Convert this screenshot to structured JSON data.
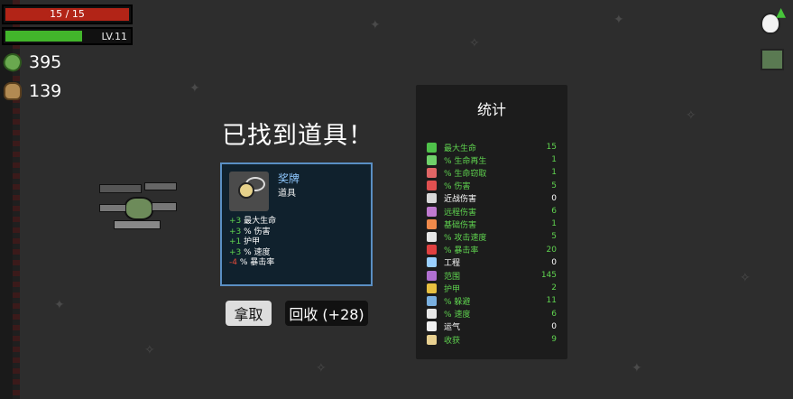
{
  "hud": {
    "hp_text": "15 / 15",
    "hp_fraction": 1.0,
    "level_text": "LV.11",
    "xp_fraction": 0.62,
    "materials": "395",
    "bag": "139"
  },
  "dialog": {
    "title": "已找到道具！",
    "item_name": "奖牌",
    "item_type": "道具",
    "effects": [
      {
        "prefix": "+3",
        "text": " 最大生命",
        "kind": "pos"
      },
      {
        "prefix": "+3",
        "text": " % 伤害",
        "kind": "pos"
      },
      {
        "prefix": "+1",
        "text": " 护甲",
        "kind": "pos"
      },
      {
        "prefix": "+3",
        "text": " % 速度",
        "kind": "pos"
      },
      {
        "prefix": "-4",
        "text": " % 暴击率",
        "kind": "neg"
      }
    ],
    "take_label": "拿取",
    "recycle_label": "回收 (+28)"
  },
  "stats": {
    "title": "统计",
    "rows": [
      {
        "icon": "heart-icon",
        "label": "最大生命",
        "value": "15",
        "color": "#5fd34f",
        "icon_color": "#4fc24a"
      },
      {
        "icon": "regen-icon",
        "label": "% 生命再生",
        "value": "1",
        "color": "#5fd34f",
        "icon_color": "#6fd06a"
      },
      {
        "icon": "lifesteal-icon",
        "label": "% 生命窃取",
        "value": "1",
        "color": "#5fd34f",
        "icon_color": "#e06666"
      },
      {
        "icon": "damage-icon",
        "label": "% 伤害",
        "value": "5",
        "color": "#5fd34f",
        "icon_color": "#e05050"
      },
      {
        "icon": "melee-icon",
        "label": "近战伤害",
        "value": "0",
        "color": "#ffffff",
        "icon_color": "#d8d8d8"
      },
      {
        "icon": "ranged-icon",
        "label": "远程伤害",
        "value": "6",
        "color": "#5fd34f",
        "icon_color": "#c07ad0"
      },
      {
        "icon": "elemental-icon",
        "label": "基础伤害",
        "value": "1",
        "color": "#5fd34f",
        "icon_color": "#f08a4b"
      },
      {
        "icon": "attack-speed-icon",
        "label": "% 攻击速度",
        "value": "5",
        "color": "#5fd34f",
        "icon_color": "#e6e6e6"
      },
      {
        "icon": "crit-icon",
        "label": "% 暴击率",
        "value": "20",
        "color": "#5fd34f",
        "icon_color": "#e04040"
      },
      {
        "icon": "engineering-icon",
        "label": "工程",
        "value": "0",
        "color": "#ffffff",
        "icon_color": "#9ad0ff"
      },
      {
        "icon": "range-icon",
        "label": "范围",
        "value": "145",
        "color": "#5fd34f",
        "icon_color": "#b070d0"
      },
      {
        "icon": "armor-icon",
        "label": "护甲",
        "value": "2",
        "color": "#5fd34f",
        "icon_color": "#e8c040"
      },
      {
        "icon": "dodge-icon",
        "label": "% 躲避",
        "value": "11",
        "color": "#5fd34f",
        "icon_color": "#7ab0e0"
      },
      {
        "icon": "speed-icon",
        "label": "% 速度",
        "value": "6",
        "color": "#5fd34f",
        "icon_color": "#e8e8e8"
      },
      {
        "icon": "luck-icon",
        "label": "运气",
        "value": "0",
        "color": "#ffffff",
        "icon_color": "#f0f0f0"
      },
      {
        "icon": "harvesting-icon",
        "label": "收获",
        "value": "9",
        "color": "#5fd34f",
        "icon_color": "#e8d090"
      }
    ]
  }
}
